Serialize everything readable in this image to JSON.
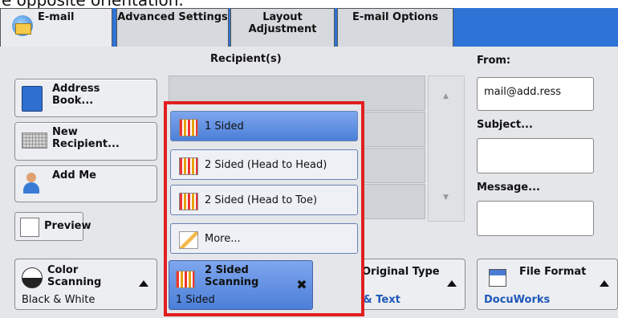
{
  "caption": "e opposite orientation.",
  "tabs": {
    "email": "E-mail",
    "advanced": "Advanced Settings",
    "layout": "Layout Adjustment",
    "email_options": "E-mail Options"
  },
  "left_buttons": {
    "address_book": "Address Book...",
    "new_recipient": "New Recipient...",
    "add_me": "Add Me",
    "preview": "Preview"
  },
  "recipients": {
    "label": "Recipient(s)"
  },
  "right_panel": {
    "from_label": "From:",
    "from_value": "mail@add.ress",
    "subject_label": "Subject...",
    "subject_value": "",
    "message_label": "Message...",
    "message_value": ""
  },
  "dropdown": {
    "items": [
      {
        "label": "1 Sided",
        "selected": true
      },
      {
        "label": "2 Sided (Head to Head)",
        "selected": false
      },
      {
        "label": "2 Sided (Head to Toe)",
        "selected": false
      },
      {
        "label": "More...",
        "selected": false
      }
    ],
    "highlight_color": "#e11f1f"
  },
  "features": {
    "color": {
      "title": "Color Scanning",
      "value": "Black & White"
    },
    "sided": {
      "title": "2 Sided Scanning",
      "value": "1 Sided"
    },
    "original": {
      "title": "Original Type",
      "value": "Photo & Text"
    },
    "format": {
      "title": "File Format",
      "value": "DocuWorks"
    }
  },
  "colors": {
    "tab_bar": "#2e73d6",
    "selected_item": "#5b8ee4",
    "link_blue": "#1f58b8"
  }
}
